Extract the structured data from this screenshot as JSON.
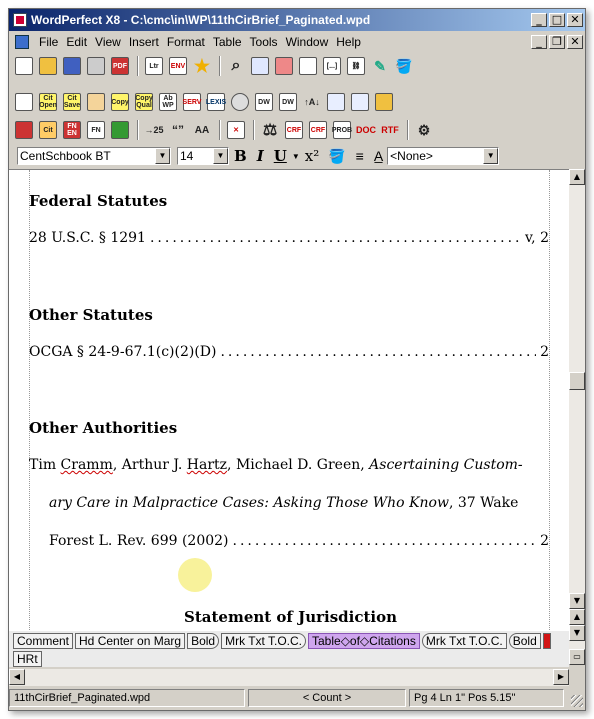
{
  "window": {
    "title": "WordPerfect X8 - C:\\cmc\\in\\WP\\11thCirBrief_Paginated.wpd"
  },
  "menu": [
    "File",
    "Edit",
    "View",
    "Insert",
    "Format",
    "Table",
    "Tools",
    "Window",
    "Help"
  ],
  "toolbar1": [
    "new",
    "open",
    "save",
    "print",
    "pdf",
    "Ltr",
    "ENV",
    "star",
    "zoom",
    "view",
    "macro",
    "insert",
    "formfield",
    "hyperlink",
    "highlight",
    "fill"
  ],
  "toolbar2": [
    "Cit Open",
    "Cit Save",
    "clipboard",
    "Copy",
    "Copy Qual",
    "Ab WP",
    "SERV",
    "LEXIS LINK",
    "cmd",
    "DW",
    "DW Sel",
    "Sort",
    "file-a",
    "file-b",
    "file-c"
  ],
  "toolbar3": [
    "Bk",
    "Cit",
    "FN EN",
    "FN Print",
    "table",
    ">25",
    "quotes",
    "AA",
    "strike",
    "scales",
    "CRF",
    "CRF2",
    "PROB LEMS",
    "DOC",
    "RTF",
    "tools"
  ],
  "fontbar": {
    "font": "CentSchbook BT",
    "size": "14",
    "bold": "B",
    "italic": "I",
    "underline": "U",
    "superscript": "x²",
    "style": "<None>"
  },
  "document": {
    "heading1": "Federal Statutes",
    "entry1_text": "28 U.S.C. § 1291",
    "entry1_page": "v, 2",
    "heading2": "Other Statutes",
    "entry2_text": "OCGA § 24-9-67.1(c)(2)(D)",
    "entry2_page": "2",
    "heading3": "Other Authorities",
    "auth_line1_prefix": "Tim ",
    "auth_line1_cramm": "Cramm",
    "auth_line1_mid": ", Arthur J. ",
    "auth_line1_hartz": "Hartz",
    "auth_line1_rest": ", Michael D. Green, ",
    "auth_line1_italic": "Ascertaining Custom-",
    "auth_line2_italic": "ary Care in Malpractice Cases: Asking Those Who Know",
    "auth_line2_rest": ", 37 Wake",
    "auth_line3_text": "Forest L. Rev. 699 (2002)",
    "auth_line3_page": "2",
    "section_title": "Statement of Jurisdiction"
  },
  "reveal_codes": {
    "row1": [
      "Comment",
      "Hd Center on Marg",
      "Bold",
      "Mrk Txt T.O.C.",
      "Table◇of◇Citations",
      "Mrk Txt T.O.C.",
      "Bold"
    ],
    "row2": [
      "HRt"
    ]
  },
  "status": {
    "filename": "11thCirBrief_Paginated.wpd",
    "count": "< Count >",
    "position": "Pg 4 Ln 1\" Pos 5.15\""
  },
  "colors": {
    "titlebar": "#0a246a",
    "selected_code": "#cfa6ee",
    "cursor_highlight": "#f7f089"
  }
}
